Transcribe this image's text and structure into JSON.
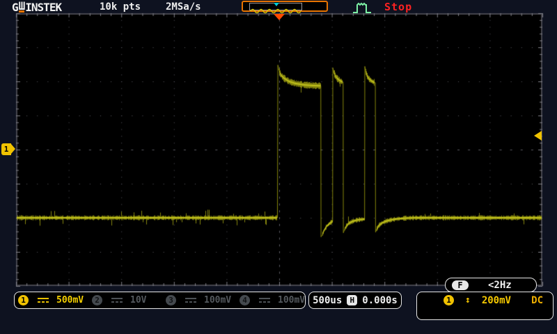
{
  "header": {
    "brand": {
      "g": "G",
      "sha": "Ш",
      "rest": "INSTEK"
    },
    "record_length": "10k pts",
    "sample_rate": "2MSa/s",
    "status": "Stop"
  },
  "markers": {
    "channel1_label": "1",
    "trigger_position_div": 5.0,
    "channel1_zero_div_from_top": 4.0,
    "trigger_level_div_from_top": 3.6
  },
  "channels": [
    {
      "label": "1",
      "scale": "500mV",
      "coupling": "DC",
      "active": true
    },
    {
      "label": "2",
      "scale": "10V",
      "coupling": "DC",
      "active": false
    },
    {
      "label": "3",
      "scale": "100mV",
      "coupling": "DC",
      "active": false
    },
    {
      "label": "4",
      "scale": "100mV",
      "coupling": "DC",
      "active": false
    }
  ],
  "timebase": {
    "scale": "500us",
    "h_badge": "H",
    "position": "0.000s"
  },
  "trigger": {
    "source": "1",
    "level_icon": "↕",
    "level": "200mV",
    "coupling": "DC",
    "f_badge": "F",
    "frequency": "<2Hz"
  },
  "graticule": {
    "x_divisions": 10,
    "y_divisions": 8,
    "subdivisions": 5
  },
  "chart_data": {
    "type": "line",
    "title": "CH1 capture: three decaying pulses after trigger",
    "x_axis": {
      "units": "us",
      "per_division": 500,
      "divisions": 10,
      "trigger_at_us": 0
    },
    "y_axis": {
      "units": "V",
      "per_division": 0.5,
      "divisions": 8,
      "zero_div_from_top": 4
    },
    "series": [
      {
        "name": "CH1",
        "color": "#b4b414",
        "points": [
          [
            -2500,
            -1.0
          ],
          [
            -20,
            -1.0
          ],
          [
            -16,
            1.24
          ],
          [
            -5,
            1.16
          ],
          [
            10,
            1.1
          ],
          [
            40,
            1.05
          ],
          [
            90,
            1.0
          ],
          [
            150,
            0.97
          ],
          [
            230,
            0.95
          ],
          [
            310,
            0.94
          ],
          [
            392,
            0.935
          ],
          [
            394,
            -1.28
          ],
          [
            405,
            -1.25
          ],
          [
            425,
            -1.18
          ],
          [
            450,
            -1.12
          ],
          [
            478,
            -1.08
          ],
          [
            504,
            -1.05
          ],
          [
            506,
            1.2
          ],
          [
            515,
            1.14
          ],
          [
            530,
            1.08
          ],
          [
            550,
            1.04
          ],
          [
            575,
            1.01
          ],
          [
            600,
            0.99
          ],
          [
            604,
            0.99
          ],
          [
            606,
            -1.22
          ],
          [
            618,
            -1.17
          ],
          [
            635,
            -1.12
          ],
          [
            660,
            -1.08
          ],
          [
            690,
            -1.055
          ],
          [
            730,
            -1.035
          ],
          [
            770,
            -1.025
          ],
          [
            808,
            -1.02
          ],
          [
            810,
            1.22
          ],
          [
            820,
            1.14
          ],
          [
            835,
            1.07
          ],
          [
            855,
            1.03
          ],
          [
            880,
            1.0
          ],
          [
            900,
            0.985
          ],
          [
            910,
            0.98
          ],
          [
            912,
            -1.21
          ],
          [
            925,
            -1.16
          ],
          [
            945,
            -1.11
          ],
          [
            975,
            -1.075
          ],
          [
            1010,
            -1.05
          ],
          [
            1060,
            -1.03
          ],
          [
            1120,
            -1.015
          ],
          [
            1200,
            -1.005
          ],
          [
            1280,
            -1.0
          ],
          [
            2500,
            -1.0
          ]
        ]
      }
    ]
  },
  "colors": {
    "background": "#0e1220",
    "screen": "#000000",
    "accent_orange": "#e87400",
    "trigger_orange": "#ff4a00",
    "trace_yellow": "#b4b414",
    "channel_yellow": "#f0c200",
    "status_red": "#ff2222",
    "trigger_icon_green": "#7df0a5",
    "memory_cyan": "#00ccd6",
    "grid_dot": "#5c5c64",
    "grid_border": "#46464e"
  }
}
